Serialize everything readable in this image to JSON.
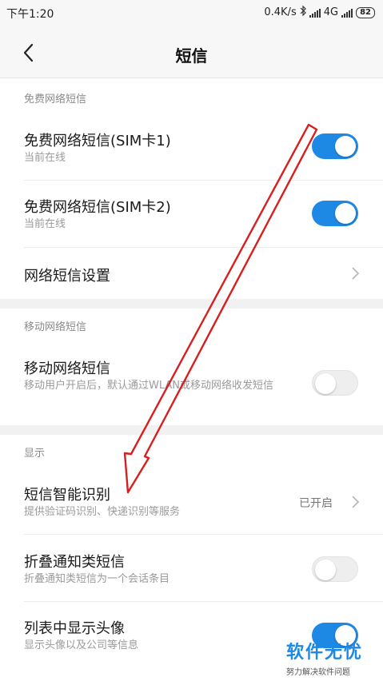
{
  "status": {
    "time": "下午1:20",
    "net_speed": "0.4K/s",
    "bluetooth_icon": "bluetooth-icon",
    "network": "4G",
    "battery": "82"
  },
  "header": {
    "title": "短信",
    "back_icon": "back-chevron-icon"
  },
  "sections": {
    "free_sms": {
      "header": "免费网络短信",
      "sim1": {
        "title": "免费网络短信(SIM卡1)",
        "subtitle": "当前在线",
        "enabled": true
      },
      "sim2": {
        "title": "免费网络短信(SIM卡2)",
        "subtitle": "当前在线",
        "enabled": true
      },
      "settings": {
        "title": "网络短信设置"
      }
    },
    "mobile_sms": {
      "header": "移动网络短信",
      "item": {
        "title": "移动网络短信",
        "subtitle": "移动用户开启后，默认通过WLAN或移动网络收发短信",
        "enabled": false
      }
    },
    "display": {
      "header": "显示",
      "smart": {
        "title": "短信智能识别",
        "subtitle": "提供验证码识别、快递识别等服务",
        "value": "已开启"
      },
      "fold": {
        "title": "折叠通知类短信",
        "subtitle": "折叠通知类短信为一个会话条目",
        "enabled": false
      },
      "avatar": {
        "title": "列表中显示头像",
        "subtitle": "显示头像以及公司等信息",
        "enabled": true
      }
    }
  },
  "watermark": {
    "title": "软件无忧",
    "subtitle": "努力解决软件问题"
  },
  "colors": {
    "accent": "#1e88e5",
    "annotation_arrow": "#d81e1e"
  }
}
